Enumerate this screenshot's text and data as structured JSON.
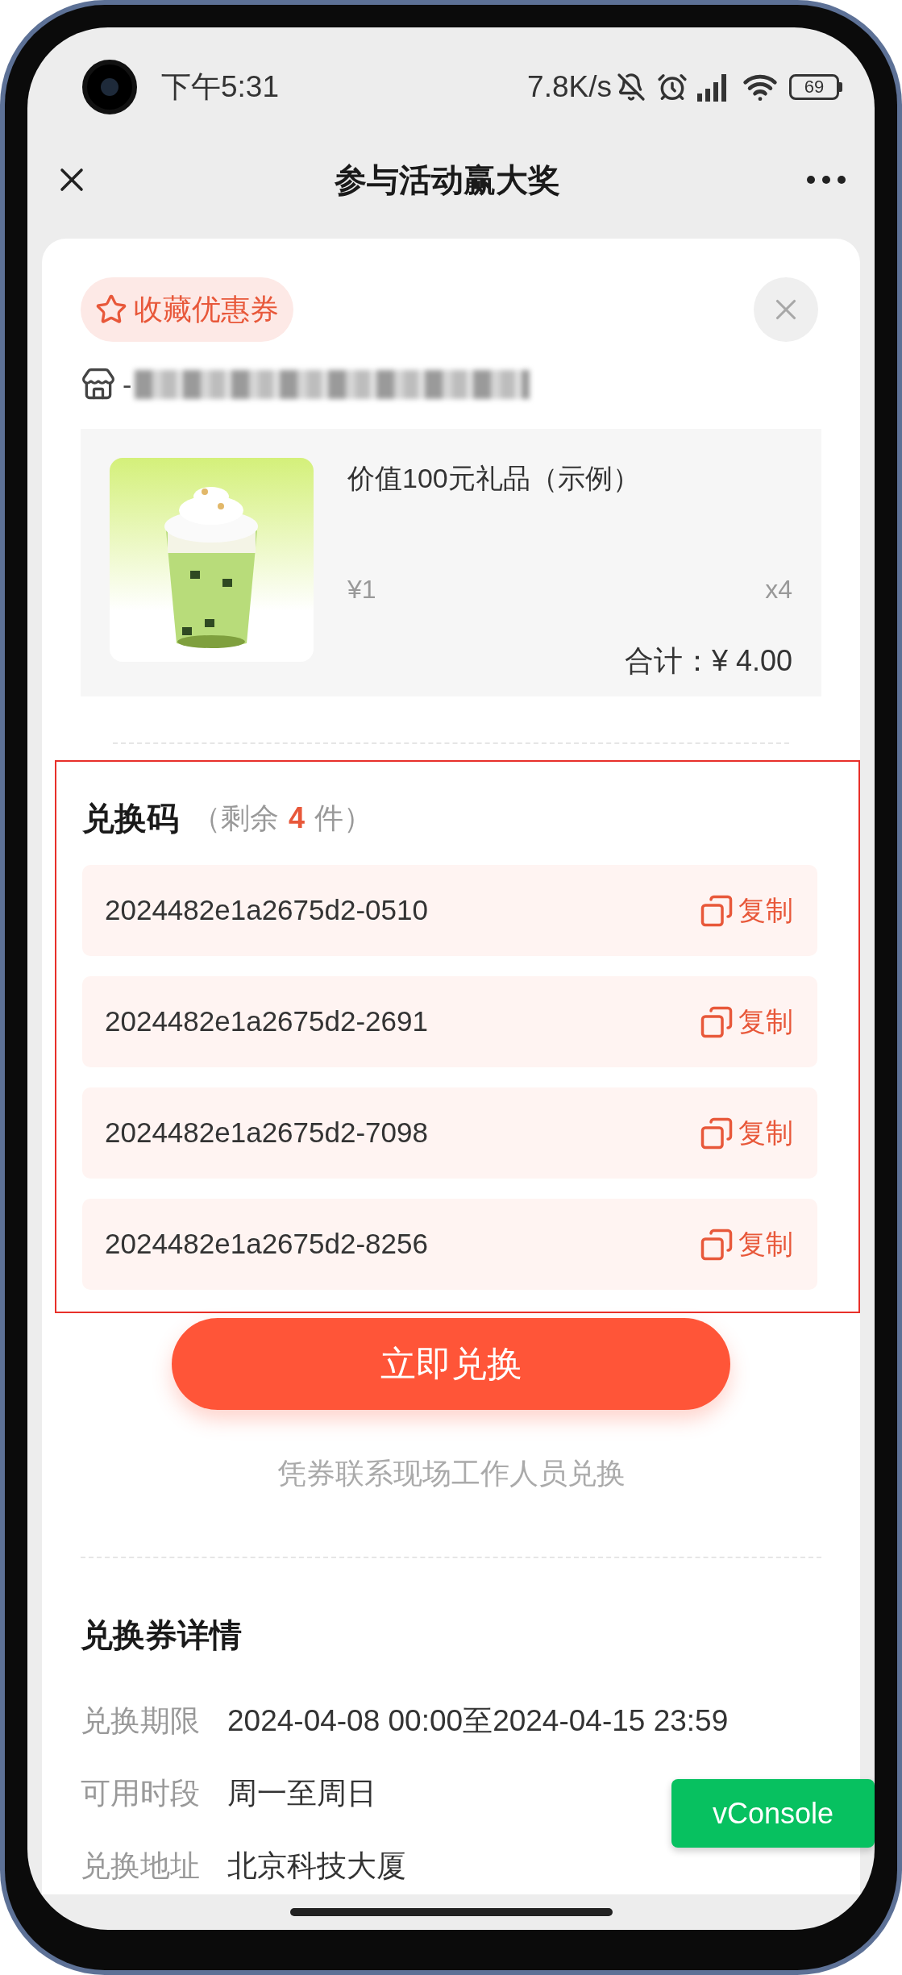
{
  "status_bar": {
    "time": "下午5:31",
    "net_speed": "7.8K/s",
    "battery": "69"
  },
  "nav_bar": {
    "title": "参与活动赢大奖"
  },
  "coupon": {
    "favorite_label": "收藏优惠券",
    "store_prefix": "-",
    "product": {
      "name": "价值100元礼品（示例）",
      "price": "¥1",
      "quantity": "x4",
      "total_label": "合计：",
      "total": "¥ 4.00"
    }
  },
  "redeem_codes": {
    "title": "兑换码",
    "remaining_open": "（剩余",
    "remaining_count": "4",
    "remaining_close": "件）",
    "codes": [
      {
        "code": "2024482e1a2675d2-0510",
        "copy_label": "复制"
      },
      {
        "code": "2024482e1a2675d2-2691",
        "copy_label": "复制"
      },
      {
        "code": "2024482e1a2675d2-7098",
        "copy_label": "复制"
      },
      {
        "code": "2024482e1a2675d2-8256",
        "copy_label": "复制"
      }
    ]
  },
  "redeem_button": "立即兑换",
  "hint": "凭券联系现场工作人员兑换",
  "details": {
    "title": "兑换券详情",
    "rows": [
      {
        "label": "兑换期限",
        "value": "2024-04-08 00:00至2024-04-15 23:59"
      },
      {
        "label": "可用时段",
        "value": "周一至周日"
      },
      {
        "label": "兑换地址",
        "value": "北京科技大厦"
      }
    ]
  },
  "vconsole": "vConsole"
}
